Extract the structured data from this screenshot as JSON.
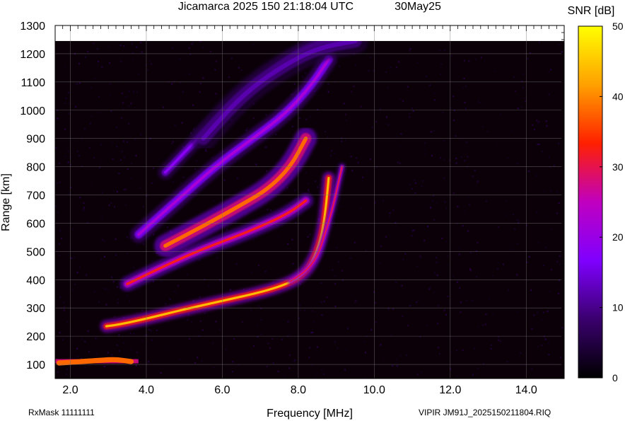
{
  "header": {
    "title": "Jicamarca 2025 150 21:18:04 UTC",
    "date": "30May25"
  },
  "footer": {
    "rxmask": "RxMask 11111111",
    "filename": "VIPIR  JM91J_2025150211804.RIQ"
  },
  "chart_data": {
    "type": "heatmap",
    "xlabel": "Frequency [MHz]",
    "ylabel": "Range [km]",
    "xlim": [
      1.6,
      15.0
    ],
    "ylim": [
      50,
      1300
    ],
    "xticks": [
      2.0,
      4.0,
      6.0,
      8.0,
      10.0,
      12.0,
      14.0
    ],
    "xtick_labels": [
      "2.0",
      "4.0",
      "6.0",
      "8.0",
      "10.0",
      "12.0",
      "14.0"
    ],
    "yticks": [
      100,
      200,
      300,
      400,
      500,
      600,
      700,
      800,
      900,
      1000,
      1100,
      1200,
      1300
    ],
    "grid": true,
    "data_top_range": 1245,
    "colorbar": {
      "label": "SNR [dB]",
      "min": 0,
      "max": 50,
      "ticks": [
        0,
        10,
        20,
        30,
        40,
        50
      ],
      "colors": [
        "#000000",
        "#3a006e",
        "#7f00ff",
        "#c000c0",
        "#ff2000",
        "#ffa000",
        "#ffff00"
      ]
    },
    "traces": [
      {
        "name": "E-region",
        "snr": 38,
        "width": 16,
        "x": [
          1.7,
          2.3,
          2.8,
          3.2,
          3.6
        ],
        "y": [
          105,
          110,
          115,
          118,
          110
        ]
      },
      {
        "name": "F-layer O-mode",
        "snr": 44,
        "width": 7,
        "x": [
          2.95,
          3.3,
          4.0,
          5.0,
          6.0,
          7.0,
          7.6,
          8.0,
          8.3,
          8.55,
          8.7,
          8.8
        ],
        "y": [
          235,
          242,
          262,
          295,
          325,
          355,
          380,
          405,
          445,
          520,
          620,
          760
        ]
      },
      {
        "name": "F-layer X-mode",
        "snr": 30,
        "width": 4,
        "x": [
          7.8,
          8.2,
          8.5,
          8.7,
          8.9,
          9.05,
          9.15
        ],
        "y": [
          395,
          430,
          480,
          560,
          650,
          740,
          800
        ]
      },
      {
        "name": "2-hop",
        "snr": 32,
        "width": 8,
        "x": [
          3.5,
          4.5,
          5.5,
          6.5,
          7.2,
          7.8,
          8.2
        ],
        "y": [
          385,
          450,
          510,
          560,
          600,
          640,
          680
        ]
      },
      {
        "name": "2-hop upper",
        "snr": 38,
        "width": 12,
        "x": [
          4.5,
          5.5,
          6.5,
          7.2,
          7.8,
          8.2
        ],
        "y": [
          520,
          590,
          665,
          720,
          800,
          900
        ]
      },
      {
        "name": "3-hop",
        "snr": 22,
        "width": 9,
        "x": [
          3.8,
          4.8,
          5.8,
          6.8,
          7.6,
          8.3,
          8.8
        ],
        "y": [
          560,
          680,
          800,
          900,
          980,
          1080,
          1180
        ]
      },
      {
        "name": "4-hop",
        "snr": 18,
        "width": 8,
        "x": [
          4.5,
          5.5,
          6.5,
          7.5,
          8.3,
          9.0
        ],
        "y": [
          780,
          920,
          1060,
          1160,
          1230,
          1245
        ]
      },
      {
        "name": "spread",
        "snr": 12,
        "width": 14,
        "x": [
          5.5,
          6.5,
          7.5,
          8.5,
          9.5
        ],
        "y": [
          900,
          1050,
          1150,
          1220,
          1245
        ]
      }
    ]
  }
}
